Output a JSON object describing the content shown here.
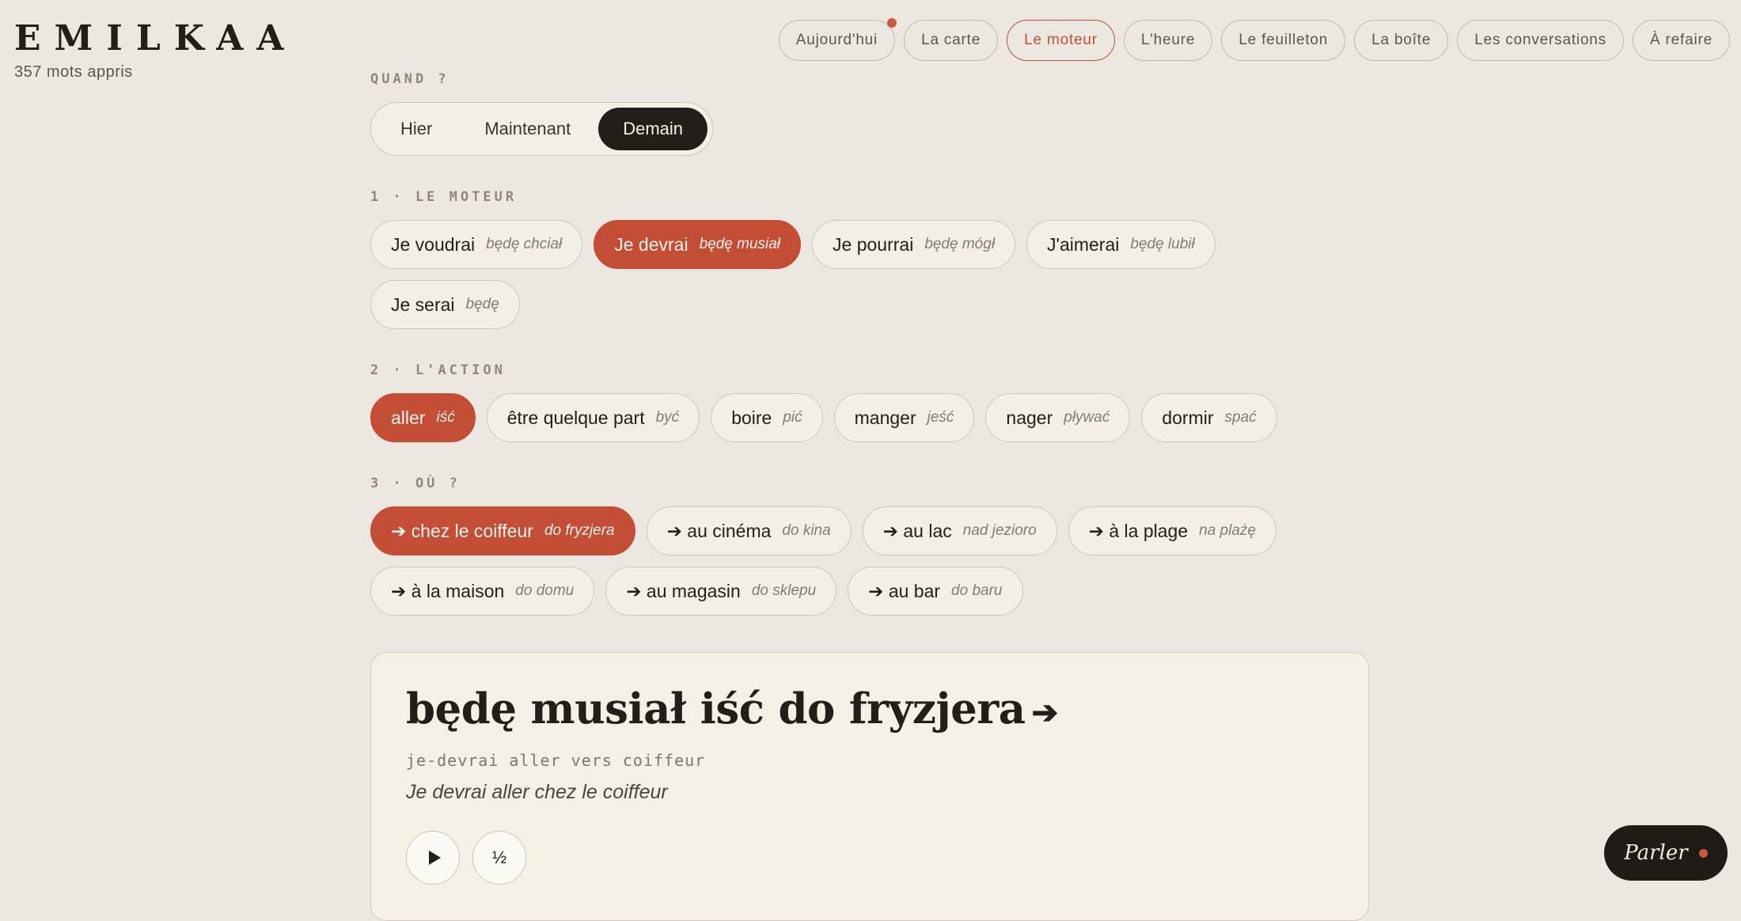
{
  "brand": {
    "name": "EMILKAA",
    "words_learned": "357 mots appris"
  },
  "nav": {
    "items": [
      {
        "label": "Aujourd'hui",
        "notification": true,
        "active": false
      },
      {
        "label": "La carte",
        "active": false
      },
      {
        "label": "Le moteur",
        "active": true
      },
      {
        "label": "L'heure",
        "active": false
      },
      {
        "label": "Le feuilleton",
        "active": false
      },
      {
        "label": "La boîte",
        "active": false
      },
      {
        "label": "Les conversations",
        "active": false
      },
      {
        "label": "À refaire",
        "active": false
      }
    ]
  },
  "when": {
    "label": "QUAND ?",
    "options": [
      {
        "label": "Hier",
        "active": false
      },
      {
        "label": "Maintenant",
        "active": false
      },
      {
        "label": "Demain",
        "active": true
      }
    ]
  },
  "engine": {
    "label": "1 · LE MOTEUR",
    "chips": [
      {
        "fr": "Je voudrai",
        "pl": "będę chciał",
        "active": false
      },
      {
        "fr": "Je devrai",
        "pl": "będę musiał",
        "active": true
      },
      {
        "fr": "Je pourrai",
        "pl": "będę mógł",
        "active": false
      },
      {
        "fr": "J'aimerai",
        "pl": "będę lubił",
        "active": false
      },
      {
        "fr": "Je serai",
        "pl": "będę",
        "active": false
      }
    ]
  },
  "action": {
    "label": "2 · L'ACTION",
    "chips": [
      {
        "fr": "aller",
        "pl": "iść",
        "active": true
      },
      {
        "fr": "être quelque part",
        "pl": "być",
        "active": false
      },
      {
        "fr": "boire",
        "pl": "pić",
        "active": false
      },
      {
        "fr": "manger",
        "pl": "jeść",
        "active": false
      },
      {
        "fr": "nager",
        "pl": "pływać",
        "active": false
      },
      {
        "fr": "dormir",
        "pl": "spać",
        "active": false
      }
    ]
  },
  "where": {
    "label": "3 · OÙ ?",
    "chips": [
      {
        "fr": "➔ chez le coiffeur",
        "pl": "do fryzjera",
        "active": true
      },
      {
        "fr": "➔ au cinéma",
        "pl": "do kina",
        "active": false
      },
      {
        "fr": "➔ au lac",
        "pl": "nad jezioro",
        "active": false
      },
      {
        "fr": "➔ à la plage",
        "pl": "na plażę",
        "active": false
      },
      {
        "fr": "➔ à la maison",
        "pl": "do domu",
        "active": false
      },
      {
        "fr": "➔ au magasin",
        "pl": "do sklepu",
        "active": false
      },
      {
        "fr": "➔ au bar",
        "pl": "do baru",
        "active": false
      }
    ]
  },
  "result": {
    "phrase": "będę musiał iść do fryzjera",
    "arrow": "➔",
    "gloss": "je-devrai aller vers coiffeur",
    "translation": "Je devrai aller chez le coiffeur",
    "slow_label": "½"
  },
  "speak": {
    "label": "Parler"
  },
  "colors": {
    "accent": "#c44d36",
    "dark": "#221f1a",
    "background": "#ece8e1",
    "card": "#f4f0e6"
  }
}
